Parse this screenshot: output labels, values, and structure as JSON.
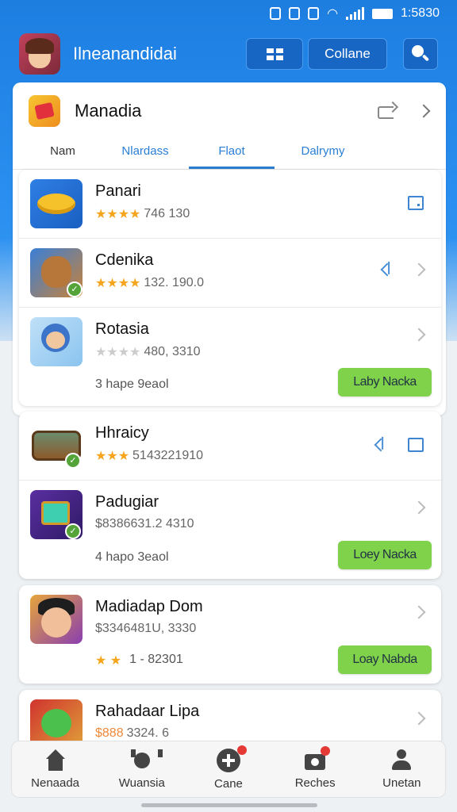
{
  "status_bar": {
    "time": "1:5830"
  },
  "app_bar": {
    "title": "Ilneanandidai",
    "collapse_label": "Collanе"
  },
  "panel": {
    "title": "Manadia",
    "tabs": [
      {
        "label": "Nam"
      },
      {
        "label": "Nlardass"
      },
      {
        "label": "Flaot"
      },
      {
        "label": "Dalrymy"
      }
    ],
    "active_tab": 2
  },
  "card1": {
    "rows": [
      {
        "name": "Panari",
        "meta": "746  130",
        "stars": "★★★★"
      },
      {
        "name": "Cdenika",
        "meta": "132. 190.0",
        "stars": "★★★★"
      },
      {
        "name": "Rotasia",
        "meta": "480, 3310",
        "stars": "★★★★",
        "footer": "3  hape  9eaol",
        "action": "Laby Nacka"
      }
    ]
  },
  "card2": {
    "rows": [
      {
        "name": "Hhraicy",
        "meta": "5143221910",
        "stars": "★★★"
      },
      {
        "name": "Padugiar",
        "meta": "$8386631.2 4310",
        "footer": "4  hapo  3eaol",
        "action": "Loey Nacka"
      }
    ]
  },
  "card3": {
    "rows": [
      {
        "name": "Madiadap Dom",
        "meta": "$3346481U, 3330",
        "footer": "1 - 82301",
        "footer_stars": "★ ★",
        "action": "Loay Nabda"
      }
    ]
  },
  "card4": {
    "rows": [
      {
        "name": "Rahadaar Lipa",
        "meta": "3324. 6",
        "meta_prefix": "$888"
      }
    ]
  },
  "bottom_nav": [
    {
      "label": "Nenaada",
      "icon": "home-icon"
    },
    {
      "label": "Wuansia",
      "icon": "creature-icon"
    },
    {
      "label": "Cane",
      "icon": "add-icon"
    },
    {
      "label": "Reches",
      "icon": "camera-icon"
    },
    {
      "label": "Unetan",
      "icon": "person-icon"
    }
  ],
  "colors": {
    "accent": "#1d7ee0",
    "action_green": "#7fd24a",
    "star": "#f4a51c"
  }
}
